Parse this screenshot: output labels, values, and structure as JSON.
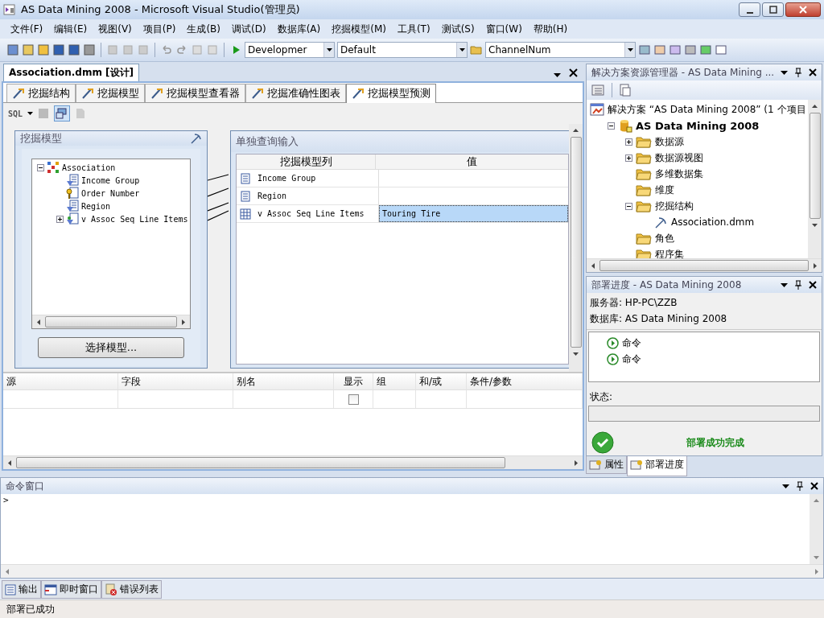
{
  "window": {
    "title": "AS Data Mining 2008 - Microsoft Visual Studio(管理员)"
  },
  "menu": [
    "文件(F)",
    "编辑(E)",
    "视图(V)",
    "项目(P)",
    "生成(B)",
    "调试(D)",
    "数据库(A)",
    "挖掘模型(M)",
    "工具(T)",
    "测试(S)",
    "窗口(W)",
    "帮助(H)"
  ],
  "toolbar": {
    "configuration": "Developmer",
    "platform": "Default",
    "find": "ChannelNum"
  },
  "document": {
    "tab": "Association.dmm [设计]",
    "designer_tabs": [
      {
        "label": "挖掘结构",
        "selected": false
      },
      {
        "label": "挖掘模型",
        "selected": false
      },
      {
        "label": "挖掘模型查看器",
        "selected": false
      },
      {
        "label": "挖掘准确性图表",
        "selected": false
      },
      {
        "label": "挖掘模型预测",
        "selected": true
      }
    ],
    "sql_label": "SQL",
    "mining_model": {
      "title": "挖掘模型",
      "tree": [
        {
          "label": "Association",
          "kind": "model",
          "expanded": true,
          "children": [
            {
              "label": "Income Group",
              "kind": "predict"
            },
            {
              "label": "Order Number",
              "kind": "key"
            },
            {
              "label": "Region",
              "kind": "predict"
            },
            {
              "label": "v Assoc Seq Line Items",
              "kind": "table",
              "expanded": false
            }
          ]
        }
      ],
      "select_button": "选择模型..."
    },
    "singleton_input": {
      "title": "单独查询输入",
      "columns": [
        "挖掘模型列",
        "值"
      ],
      "rows": [
        {
          "column": "Income Group",
          "kind": "column",
          "selected": false
        },
        {
          "column": "Region",
          "kind": "column",
          "selected": false
        },
        {
          "column": "v Assoc Seq Line Items",
          "kind": "table",
          "value": "Touring Tire",
          "selected": true
        }
      ]
    },
    "query_grid": {
      "columns": [
        "源",
        "字段",
        "别名",
        "显示",
        "组",
        "和/或",
        "条件/参数"
      ],
      "rows": [
        {
          "show": false
        }
      ]
    }
  },
  "solution_explorer": {
    "title": "解决方案资源管理器 - AS Data Mining ...",
    "tree": [
      {
        "label": "解决方案 “AS Data Mining 2008” (1 个项目",
        "kind": "solution",
        "children": [
          {
            "label": "AS Data Mining 2008",
            "kind": "project",
            "expanded": true,
            "children": [
              {
                "label": "数据源",
                "kind": "folder",
                "expanded": false
              },
              {
                "label": "数据源视图",
                "kind": "folder",
                "expanded": false
              },
              {
                "label": "多维数据集",
                "kind": "folder"
              },
              {
                "label": "维度",
                "kind": "folder"
              },
              {
                "label": "挖掘结构",
                "kind": "folder",
                "expanded": true,
                "children": [
                  {
                    "label": "Association.dmm",
                    "kind": "file"
                  }
                ]
              },
              {
                "label": "角色",
                "kind": "folder"
              },
              {
                "label": "程序集",
                "kind": "folder"
              }
            ]
          }
        ]
      }
    ]
  },
  "deploy_progress": {
    "title": "部署进度 - AS Data Mining 2008",
    "server": "服务器: HP-PC\\ZZB",
    "database": "数据库: AS Data Mining 2008",
    "commands": [
      "命令",
      "命令"
    ],
    "status_label": "状态:",
    "result": "部署成功完成"
  },
  "right_tabs": [
    {
      "label": "属性",
      "selected": false
    },
    {
      "label": "部署进度",
      "selected": true
    }
  ],
  "command_window": {
    "title": "命令窗口",
    "prompt": ">"
  },
  "bottom_tabs": [
    {
      "label": "输出",
      "kind": "output"
    },
    {
      "label": "即时窗口",
      "kind": "immediate"
    },
    {
      "label": "错误列表",
      "kind": "errors"
    }
  ],
  "status_bar": "部署已成功"
}
